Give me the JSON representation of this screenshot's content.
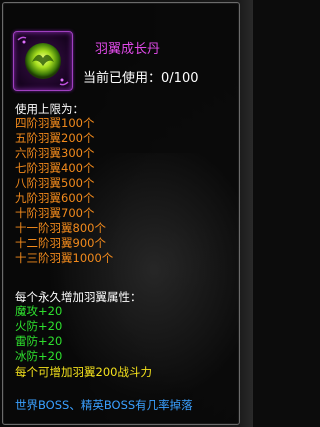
{
  "tooltip": {
    "item_name": "羽翼成长丹",
    "item_icon": "green-orb-icon",
    "usage_label": "当前已使用：",
    "usage_value": "0/100",
    "limit_title": "使用上限为：",
    "limits": [
      "四阶羽翼100个",
      "五阶羽翼200个",
      "六阶羽翼300个",
      "七阶羽翼400个",
      "八阶羽翼500个",
      "九阶羽翼600个",
      "十阶羽翼700个",
      "十一阶羽翼800个",
      "十二阶羽翼900个",
      "十三阶羽翼1000个"
    ],
    "bonus_title": "每个永久增加羽翼属性：",
    "bonuses": [
      "魔攻+20",
      "火防+20",
      "雷防+20",
      "冰防+20"
    ],
    "power_note": "每个可增加羽翼200战斗力",
    "source_note": "世界BOSS、精英BOSS有几率掉落"
  },
  "colors": {
    "name": "#e04ae8",
    "limits": "#f28a1c",
    "bonuses": "#2ee02e",
    "power": "#f5e21c",
    "source": "#3aa0ff",
    "border": "#6b6b6b"
  }
}
